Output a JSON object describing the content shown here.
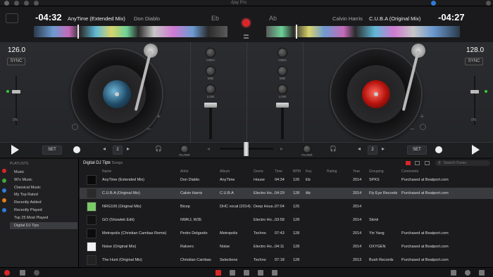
{
  "titlebar": {
    "app_title": "djay Pro"
  },
  "deck_left": {
    "time": "-04:32",
    "track": "AnyTime (Extended Mix)",
    "artist": "Don Diablo",
    "key": "Eb",
    "bpm": "126.0",
    "sync": "SYNC",
    "pitch": "0%",
    "set": "SET",
    "loop": "2"
  },
  "deck_right": {
    "time": "-04:27",
    "track": "C.U.B.A (Original Mix)",
    "artist": "Calvin Harris",
    "key": "Ab",
    "bpm": "128.0",
    "sync": "SYNC",
    "pitch": "0%",
    "set": "SET",
    "loop": "2"
  },
  "mixer": {
    "high": "HIGH",
    "mid": "MID",
    "low": "LOW",
    "filter_l": "FILTER",
    "filter_r": "FILTER"
  },
  "library": {
    "header": "Digital DJ Tips",
    "count": "30 Songs",
    "search_placeholder": "Search iTunes",
    "playlists_label": "PLAYLISTS",
    "playlists": [
      "Music",
      "90's Music",
      "Classical Music",
      "My Top Rated",
      "Recently Added",
      "Recently Played",
      "Top 25 Most Played",
      "Digital DJ Tips"
    ],
    "columns": [
      "Name",
      "Artist",
      "Album",
      "Genre",
      "Time",
      "BPM",
      "Key",
      "Rating",
      "Year",
      "Grouping",
      "Comments"
    ],
    "rows": [
      {
        "name": "AnyTime (Extended Mix)",
        "artist": "Don Diablo",
        "album": "AnyTime",
        "genre": "House",
        "time": "04:34",
        "bpm": "126",
        "key": "Eb",
        "year": "2014",
        "grouping": "SPKS",
        "comments": "Purchased at Beatport.com"
      },
      {
        "name": "C.U.B.A (Original Mix)",
        "artist": "Calvin Harris",
        "album": "C.U.B.A",
        "genre": "Electro Ho...",
        "time": "04:29",
        "bpm": "128",
        "key": "Ab",
        "year": "2014",
        "grouping": "Fly Eye Records",
        "comments": "Purchased at Beatport.com"
      },
      {
        "name": "NRG106 (Original Mix)",
        "artist": "Bicep",
        "album": "DHC vocal (2014) 26",
        "genre": "Deep Hous...",
        "time": "07:04",
        "bpm": "125",
        "key": "",
        "year": "2014",
        "grouping": "",
        "comments": ""
      },
      {
        "name": "GO (Showtek Edit)",
        "artist": "NWKJ, W35",
        "album": "",
        "genre": "Electro Ho...",
        "time": "03:58",
        "bpm": "128",
        "key": "",
        "year": "2014",
        "grouping": "Skink",
        "comments": ""
      },
      {
        "name": "Metropolis (Christian Cambas Remix)",
        "artist": "Pedro Delgardo",
        "album": "Metropolis",
        "genre": "Techno",
        "time": "07:43",
        "bpm": "128",
        "key": "",
        "year": "2014",
        "grouping": "Yin Yang",
        "comments": "Purchased at Beatport.com"
      },
      {
        "name": "Noise (Original Mix)",
        "artist": "Ralvero",
        "album": "Noise",
        "genre": "Electro Ho...",
        "time": "04:11",
        "bpm": "128",
        "key": "",
        "year": "2014",
        "grouping": "OXYGEN",
        "comments": "Purchased at Beatport.com"
      },
      {
        "name": "The Hunt (Original Mix)",
        "artist": "Christian Cambas",
        "album": "Selections",
        "genre": "Techno",
        "time": "07:18",
        "bpm": "128",
        "key": "",
        "year": "2013",
        "grouping": "Bush Records",
        "comments": "Purchased at Beatport.com"
      }
    ]
  },
  "colors": {
    "record": "#d9252a",
    "accent_blue": "#2f7bd8",
    "selected_row": "#3a3b3e"
  }
}
